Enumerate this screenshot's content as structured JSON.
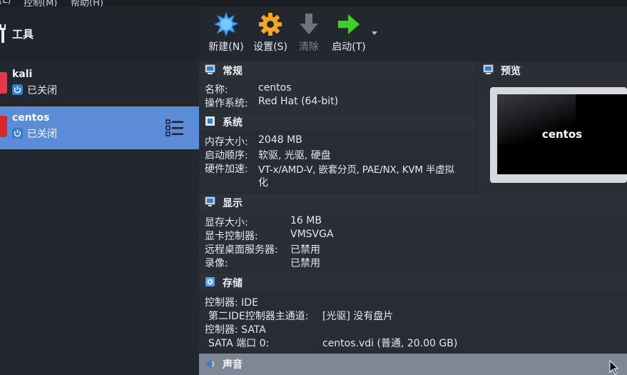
{
  "menubar": {
    "items": [
      "(L)",
      "控制(M)",
      "帮助(H)"
    ]
  },
  "tools": {
    "label": "工具"
  },
  "vms": [
    {
      "name": "kali",
      "state": "已关闭"
    },
    {
      "name": "centos",
      "state": "已关闭"
    }
  ],
  "toolbar": {
    "new": "新建(N)",
    "settings": "设置(S)",
    "clear": "清除",
    "start": "启动(T)"
  },
  "general": {
    "title": "常规",
    "rows": [
      {
        "k": "名称:",
        "v": "centos"
      },
      {
        "k": "操作系统:",
        "v": "Red Hat (64-bit)"
      }
    ]
  },
  "system": {
    "title": "系统",
    "rows": [
      {
        "k": "内存大小:",
        "v": "2048 MB"
      },
      {
        "k": "启动顺序:",
        "v": "软驱, 光驱, 硬盘"
      },
      {
        "k": "硬件加速:",
        "v": "VT-x/AMD-V, 嵌套分页, PAE/NX, KVM 半虚拟",
        "v2": "化"
      }
    ]
  },
  "display": {
    "title": "显示",
    "rows": [
      {
        "k": "显存大小:",
        "v": "16 MB"
      },
      {
        "k": "显卡控制器:",
        "v": "VMSVGA"
      },
      {
        "k": "远程桌面服务器:",
        "v": "已禁用"
      },
      {
        "k": "录像:",
        "v": "已禁用"
      }
    ]
  },
  "storage": {
    "title": "存储",
    "rows": [
      {
        "k": "控制器: IDE",
        "v": ""
      },
      {
        "k": " 第二IDE控制器主通道:",
        "v": "[光驱] 没有盘片"
      },
      {
        "k": "控制器: SATA",
        "v": ""
      },
      {
        "k": " SATA 端口 0:",
        "v": "centos.vdi (普通, 20.00 GB)"
      }
    ]
  },
  "audio": {
    "title": "声音"
  },
  "preview": {
    "title": "预览",
    "vm_name": "centos"
  },
  "colors": {
    "selection": "#5c8bd8",
    "start_arrow": "#3fcf2a",
    "settings_gear": "#f5a623",
    "new_star": "#4aa8f0"
  }
}
